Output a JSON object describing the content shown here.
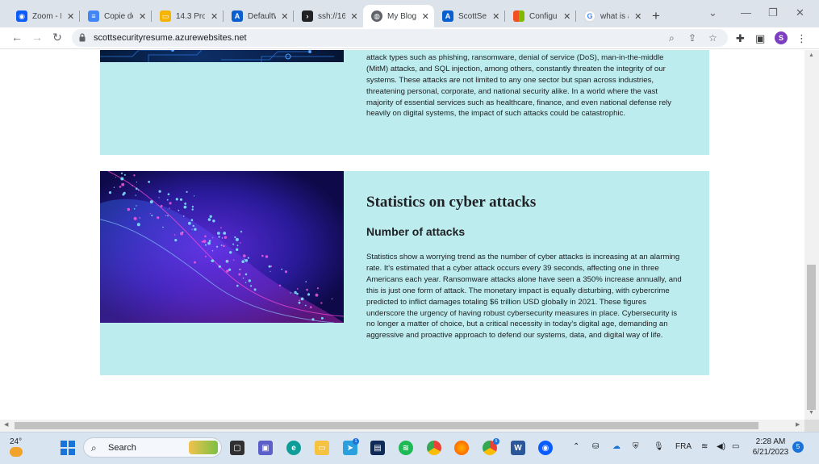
{
  "browser": {
    "tabs": [
      {
        "title": "Zoom - F",
        "icon": "zoom-icon",
        "color": "#0b5cff"
      },
      {
        "title": "Copie de",
        "icon": "google-docs-icon",
        "color": "#4285f4"
      },
      {
        "title": "14.3 Prol",
        "icon": "slides-icon",
        "color": "#f4b400"
      },
      {
        "title": "DefaultW",
        "icon": "azure-icon",
        "color": "#0a5fd0"
      },
      {
        "title": "ssh://16",
        "icon": "terminal-icon",
        "color": "#202124"
      },
      {
        "title": "My Blog",
        "icon": "globe-icon",
        "color": "#5f6368",
        "active": true
      },
      {
        "title": "ScottSec",
        "icon": "azure-icon",
        "color": "#0a5fd0"
      },
      {
        "title": "Configur",
        "icon": "microsoft-icon",
        "color": "#f25022"
      },
      {
        "title": "what is a",
        "icon": "google-icon",
        "color": "#4285f4"
      }
    ],
    "url": "scottsecurityresume.azurewebsites.net"
  },
  "page": {
    "card1": {
      "text": "which unfortunately also increases the potential attack surface for hackers. A multitude of attack types such as phishing, ransomware, denial of service (DoS), man-in-the-middle (MitM) attacks, and SQL injection, among others, constantly threaten the integrity of our systems. These attacks are not limited to any one sector but span across industries, threatening personal, corporate, and national security alike. In a world where the vast majority of essential services such as healthcare, finance, and even national defense rely heavily on digital systems, the impact of such attacks could be catastrophic."
    },
    "card2": {
      "heading": "Statistics on cyber attacks",
      "subheading": "Number of attacks",
      "text": "Statistics show a worrying trend as the number of cyber attacks is increasing at an alarming rate. It's estimated that a cyber attack occurs every 39 seconds, affecting one in three Americans each year. Ransomware attacks alone have seen a 350% increase annually, and this is just one form of attack. The monetary impact is equally disturbing, with cybercrime predicted to inflict damages totaling $6 trillion USD globally in 2021. These figures underscore the urgency of having robust cybersecurity measures in place. Cybersecurity is no longer a matter of choice, but a critical necessity in today's digital age, demanding an aggressive and proactive approach to defend our systems, data, and digital way of life."
    }
  },
  "taskbar": {
    "weather": "24°",
    "search_label": "Search",
    "language": "FRA",
    "time": "2:28 AM",
    "date": "6/21/2023",
    "notifications": "5",
    "badge_telegram": "1",
    "badge_chrome2": "5"
  }
}
